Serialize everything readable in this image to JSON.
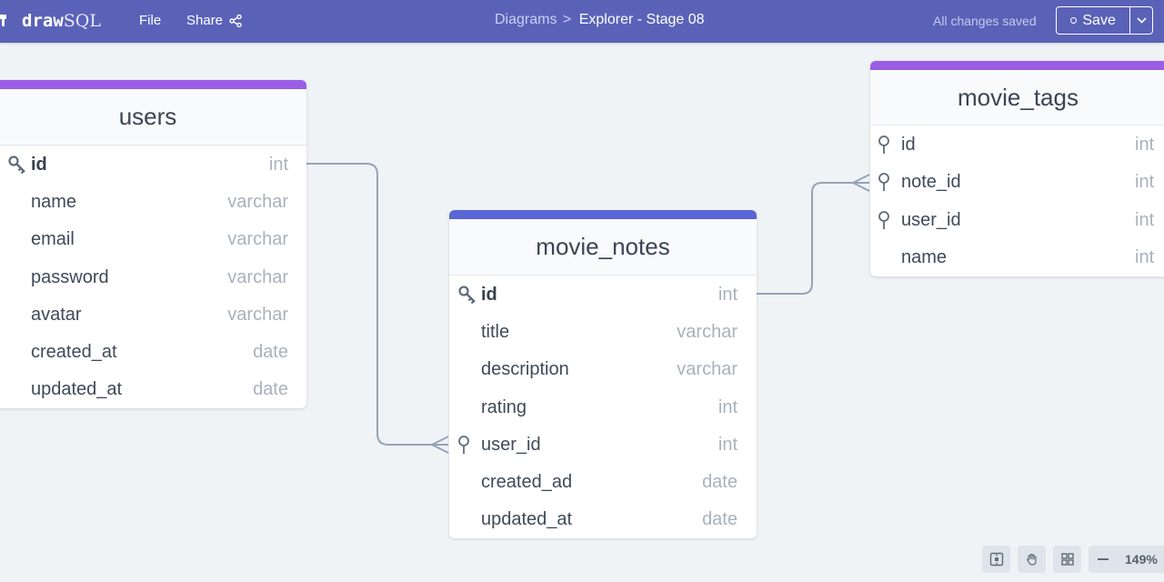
{
  "app": {
    "logo_bold": "draw",
    "logo_light": "SQL"
  },
  "menu": {
    "file": "File",
    "share": "Share"
  },
  "breadcrumb": {
    "root": "Diagrams",
    "separator": ">",
    "current": "Explorer - Stage 08"
  },
  "status": {
    "saved": "All changes saved"
  },
  "save": {
    "label": "Save"
  },
  "colors": {
    "topbar": "#5a62b8",
    "accent_purple": "#9b5de5",
    "accent_blue": "#5b66d6",
    "canvas": "#eff3f6",
    "relation_line": "#94a3b8"
  },
  "tables": [
    {
      "name": "users",
      "accent": "#9b5de5",
      "columns": [
        {
          "name": "id",
          "type": "int",
          "key": "primary"
        },
        {
          "name": "name",
          "type": "varchar",
          "key": ""
        },
        {
          "name": "email",
          "type": "varchar",
          "key": ""
        },
        {
          "name": "password",
          "type": "varchar",
          "key": ""
        },
        {
          "name": "avatar",
          "type": "varchar",
          "key": ""
        },
        {
          "name": "created_at",
          "type": "date",
          "key": ""
        },
        {
          "name": "updated_at",
          "type": "date",
          "key": ""
        }
      ]
    },
    {
      "name": "movie_notes",
      "accent": "#5b66d6",
      "columns": [
        {
          "name": "id",
          "type": "int",
          "key": "primary"
        },
        {
          "name": "title",
          "type": "varchar",
          "key": ""
        },
        {
          "name": "description",
          "type": "varchar",
          "key": ""
        },
        {
          "name": "rating",
          "type": "int",
          "key": ""
        },
        {
          "name": "user_id",
          "type": "int",
          "key": "foreign"
        },
        {
          "name": "created_ad",
          "type": "date",
          "key": ""
        },
        {
          "name": "updated_at",
          "type": "date",
          "key": ""
        }
      ]
    },
    {
      "name": "movie_tags",
      "accent": "#9b5de5",
      "columns": [
        {
          "name": "id",
          "type": "int",
          "key": "foreign"
        },
        {
          "name": "note_id",
          "type": "int",
          "key": "foreign"
        },
        {
          "name": "user_id",
          "type": "int",
          "key": "foreign"
        },
        {
          "name": "name",
          "type": "int",
          "key": ""
        }
      ]
    }
  ],
  "toolbar": {
    "tools": [
      "fit-view-icon",
      "pan-hand-icon",
      "grid-icon",
      "zoom-out-icon"
    ],
    "zoom": "149%"
  }
}
